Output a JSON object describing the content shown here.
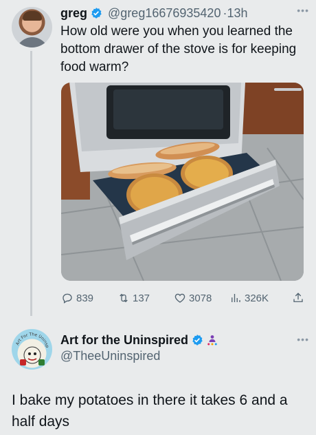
{
  "tweet1": {
    "name": "greg",
    "handle": "@greg16676935420",
    "separator": "·",
    "time": "13h",
    "text": "How old were you when you learned the bottom drawer of the stove is for keeping food warm?",
    "stats": {
      "replies": "839",
      "retweets": "137",
      "likes": "3078",
      "views": "326K"
    }
  },
  "tweet2": {
    "name": "Art for the Uninspired",
    "handle": "@TheeUninspired",
    "avatar_lettering": "Art For The Uninspired",
    "text": "I bake my potatoes in there it takes 6 and a half days"
  },
  "icons": {
    "verified": "verified-badge-icon",
    "more": "more-dots-icon",
    "reply": "reply-icon",
    "retweet": "retweet-icon",
    "like": "heart-icon",
    "views": "views-bar-icon",
    "share": "share-icon",
    "affiliate": "affiliate-badge-icon"
  },
  "colors": {
    "verified_blue": "#1d9bf0",
    "text_primary": "#0f1419",
    "text_secondary": "#536471",
    "background": "#e9ebec"
  }
}
